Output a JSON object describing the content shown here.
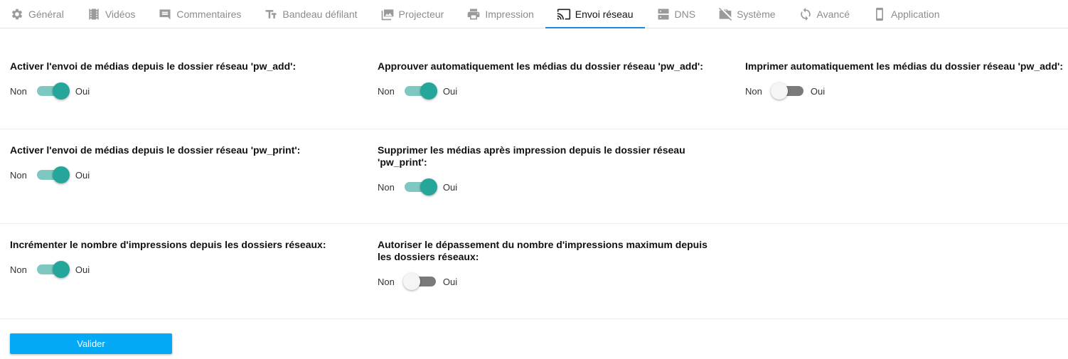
{
  "tabs": [
    {
      "label": "Général",
      "icon": "gear-icon",
      "active": false
    },
    {
      "label": "Vidéos",
      "icon": "film-icon",
      "active": false
    },
    {
      "label": "Commentaires",
      "icon": "comment-icon",
      "active": false
    },
    {
      "label": "Bandeau défilant",
      "icon": "text-size-icon",
      "active": false
    },
    {
      "label": "Projecteur",
      "icon": "images-icon",
      "active": false
    },
    {
      "label": "Impression",
      "icon": "printer-icon",
      "active": false
    },
    {
      "label": "Envoi réseau",
      "icon": "cast-icon",
      "active": true
    },
    {
      "label": "DNS",
      "icon": "dns-icon",
      "active": false
    },
    {
      "label": "Système",
      "icon": "work-off-icon",
      "active": false
    },
    {
      "label": "Avancé",
      "icon": "sync-icon",
      "active": false
    },
    {
      "label": "Application",
      "icon": "phone-icon",
      "active": false
    }
  ],
  "switch_labels": {
    "off": "Non",
    "on": "Oui"
  },
  "settings": {
    "pw_add_enable": {
      "label": "Activer l'envoi de médias depuis le dossier réseau 'pw_add':",
      "value": true
    },
    "pw_add_approve": {
      "label": "Approuver automatiquement les médias du dossier réseau 'pw_add':",
      "value": true
    },
    "pw_add_print": {
      "label": "Imprimer automatiquement les médias du dossier réseau 'pw_add':",
      "value": false
    },
    "pw_print_enable": {
      "label": "Activer l'envoi de médias depuis le dossier réseau 'pw_print':",
      "value": true
    },
    "pw_print_delete": {
      "label": "Supprimer les médias après impression depuis le dossier réseau 'pw_print':",
      "value": true
    },
    "increment_prints": {
      "label": "Incrémenter le nombre d'impressions depuis les dossiers réseaux:",
      "value": true
    },
    "allow_exceed": {
      "label": "Autoriser le dépassement du nombre d'impressions maximum depuis les dossiers réseaux:",
      "value": false
    }
  },
  "colors": {
    "accent": "#26a69a",
    "tab_indicator": "#1e88e5",
    "button": "#03a9f4"
  },
  "submit_label": "Valider"
}
